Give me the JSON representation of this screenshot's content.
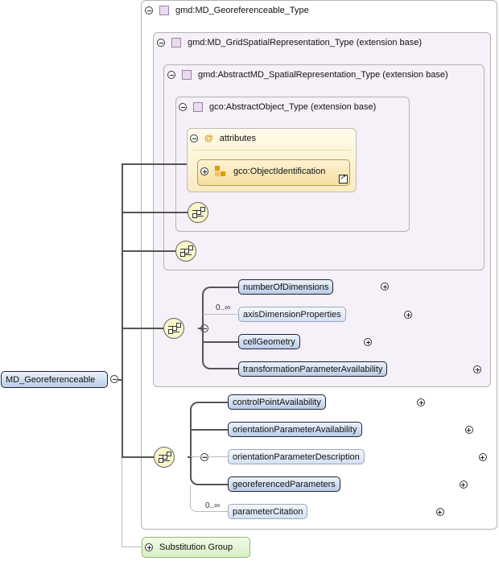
{
  "root": {
    "type_label": "gmd:MD_Georeferenceable_Type",
    "element_label": "MD_Georeferenceable",
    "substitution_label": "Substitution Group"
  },
  "grid_type": {
    "label": "gmd:MD_GridSpatialRepresentation_Type (extension base)"
  },
  "abstract_spatial": {
    "label": "gmd:AbstractMD_SpatialRepresentation_Type (extension base)"
  },
  "abstract_object": {
    "label": "gco:AbstractObject_Type (extension base)"
  },
  "attributes": {
    "icon": "@",
    "label": "attributes",
    "group_label": "gco:ObjectIdentification"
  },
  "grid_elements": [
    {
      "label": "numberOfDimensions",
      "occurrence": ""
    },
    {
      "label": "axisDimensionProperties",
      "occurrence": "0..∞"
    },
    {
      "label": "cellGeometry",
      "occurrence": ""
    },
    {
      "label": "transformationParameterAvailability",
      "occurrence": ""
    }
  ],
  "geo_elements": [
    {
      "label": "controlPointAvailability",
      "occurrence": ""
    },
    {
      "label": "orientationParameterAvailability",
      "occurrence": ""
    },
    {
      "label": "orientationParameterDescription",
      "occurrence": ""
    },
    {
      "label": "georeferencedParameters",
      "occurrence": ""
    },
    {
      "label": "parameterCitation",
      "occurrence": "0..∞"
    }
  ],
  "colors": {
    "type_box_fill": "#f6f0f8",
    "element_fill_top": "#ecf2fb",
    "element_fill_bottom": "#b9cde8",
    "sequence_fill": "#fbf6c8",
    "attribute_fill": "#f5dd9e",
    "substitution_fill": "#d8efc3"
  },
  "icons": {
    "collapse": "minus-circle-icon",
    "expand": "plus-circle-icon",
    "sequence": "sequence-compositor-icon",
    "type": "complex-type-icon",
    "attribute_group": "attribute-group-icon",
    "link": "external-link-icon"
  }
}
